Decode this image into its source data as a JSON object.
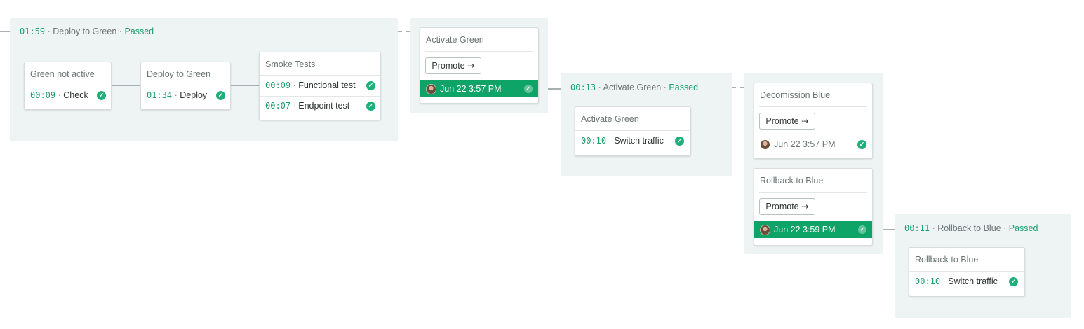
{
  "stage_deploy": {
    "duration": "01:59",
    "name": "Deploy to Green",
    "status": "Passed",
    "jobs": [
      {
        "title": "Green not active",
        "time": "00:09",
        "step": "Check"
      },
      {
        "title": "Deploy to Green",
        "time": "01:34",
        "step": "Deploy"
      }
    ],
    "smoke": {
      "title": "Smoke Tests",
      "rows": [
        {
          "time": "00:09",
          "step": "Functional test"
        },
        {
          "time": "00:07",
          "step": "Endpoint test"
        }
      ]
    }
  },
  "promo_activate": {
    "title": "Activate Green",
    "button": "Promote ⇢",
    "date": "Jun 22 3:57 PM"
  },
  "stage_activate": {
    "duration": "00:13",
    "name": "Activate Green",
    "status": "Passed",
    "job": {
      "title": "Activate Green",
      "time": "00:10",
      "step": "Switch traffic"
    }
  },
  "promo_decomission": {
    "title": "Decomission Blue",
    "button": "Promote ⇢",
    "date": "Jun 22 3:57 PM"
  },
  "promo_rollback": {
    "title": "Rollback to Blue",
    "button": "Promote ⇢",
    "date": "Jun 22 3:59 PM"
  },
  "stage_rollback": {
    "duration": "00:11",
    "name": "Rollback to Blue",
    "status": "Passed",
    "job": {
      "title": "Rollback to Blue",
      "time": "00:10",
      "step": "Switch traffic"
    }
  },
  "separator": "·",
  "icons": {
    "check": "check-circle-icon",
    "avatar": "user-avatar"
  },
  "colors": {
    "success": "#1fb07a",
    "promoted_bar": "#0ea367",
    "panel": "#eef3f3"
  }
}
